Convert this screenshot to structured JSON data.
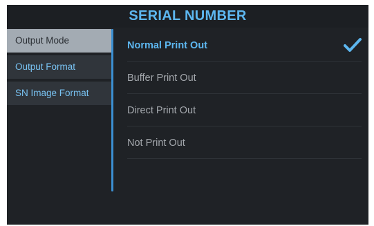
{
  "header": {
    "title": "SERIAL NUMBER"
  },
  "sidebar": {
    "items": [
      {
        "label": "Output Mode",
        "active": true
      },
      {
        "label": "Output Format",
        "active": false
      },
      {
        "label": "SN Image Format",
        "active": false
      }
    ]
  },
  "options": [
    {
      "label": "Normal Print Out",
      "selected": true
    },
    {
      "label": "Buffer Print Out",
      "selected": false
    },
    {
      "label": "Direct Print Out",
      "selected": false
    },
    {
      "label": "Not Print Out",
      "selected": false
    }
  ],
  "icons": {
    "selected_marker": "checkmark-icon"
  },
  "colors": {
    "accent": "#5db7f0",
    "background": "#1f2226",
    "sidebar_active": "#a3abb3",
    "sidebar_item": "#30353b"
  }
}
